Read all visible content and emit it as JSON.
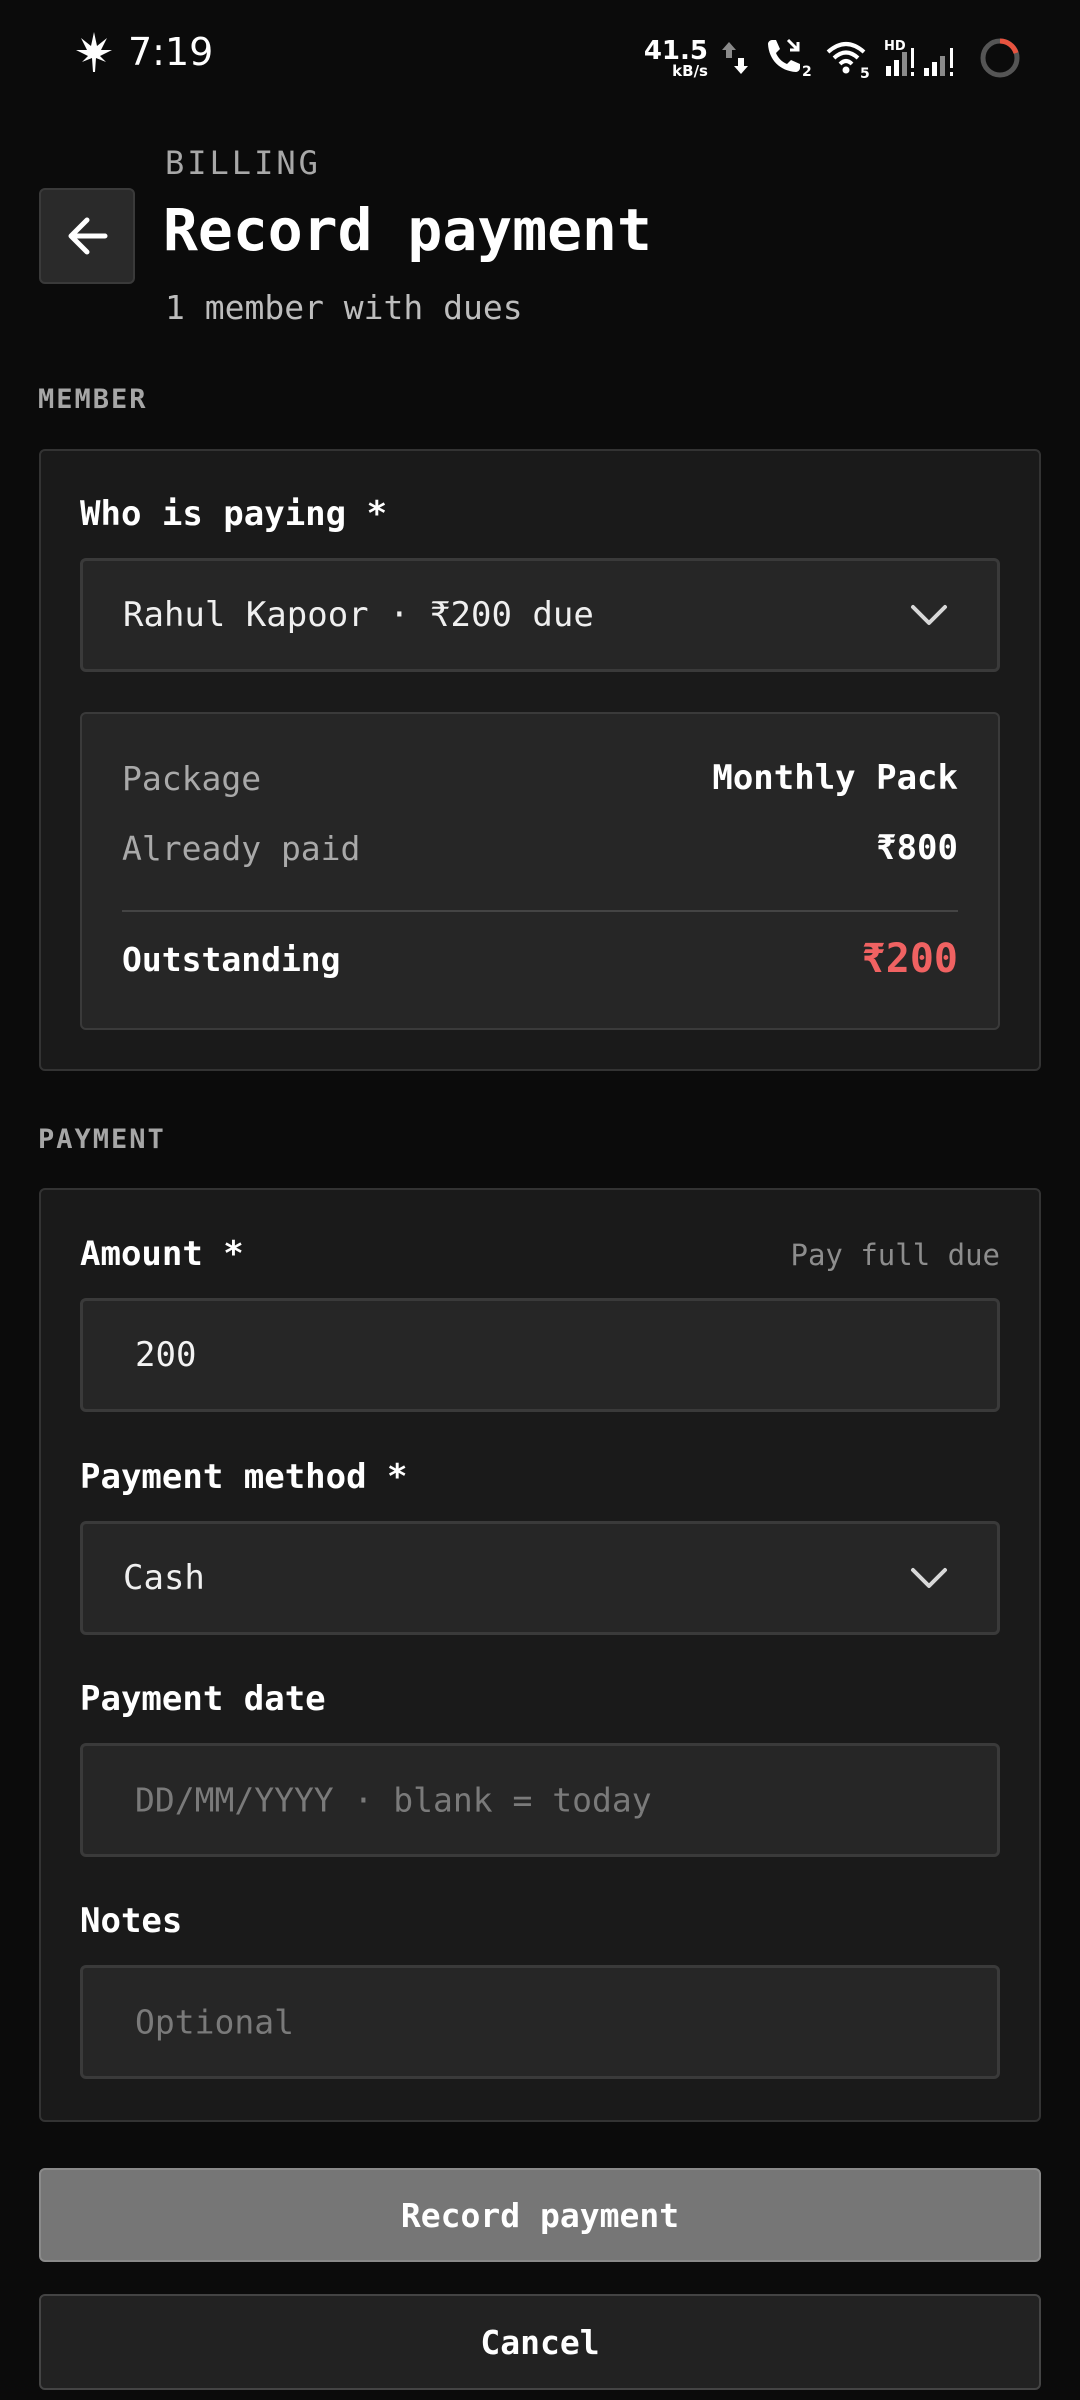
{
  "status_bar": {
    "time": "7:19",
    "net_speed": "41.5",
    "net_unit": "kB/s",
    "call_badge": "2",
    "wifi_badge": "5",
    "hd_label": "HD"
  },
  "header": {
    "eyebrow": "BILLING",
    "title": "Record payment",
    "subtitle": "1 member with dues"
  },
  "member_section": {
    "label": "MEMBER",
    "who_label": "Who is paying *",
    "selected_member": "Rahul Kapoor · ₹200 due",
    "summary": {
      "package_key": "Package",
      "package_value": "Monthly Pack",
      "paid_key": "Already paid",
      "paid_value": "₹800",
      "outstanding_key": "Outstanding",
      "outstanding_value": "₹200"
    }
  },
  "payment_section": {
    "label": "PAYMENT",
    "amount_label": "Amount *",
    "pay_full_link": "Pay full due",
    "amount_value": "200",
    "method_label": "Payment method *",
    "method_value": "Cash",
    "date_label": "Payment date",
    "date_placeholder": "DD/MM/YYYY · blank = today",
    "notes_label": "Notes",
    "notes_placeholder": "Optional"
  },
  "actions": {
    "primary": "Record payment",
    "secondary": "Cancel"
  },
  "colors": {
    "background": "#0b0b0b",
    "card": "#1a1a1a",
    "due": "#f06262",
    "primary_button": "#767676"
  }
}
